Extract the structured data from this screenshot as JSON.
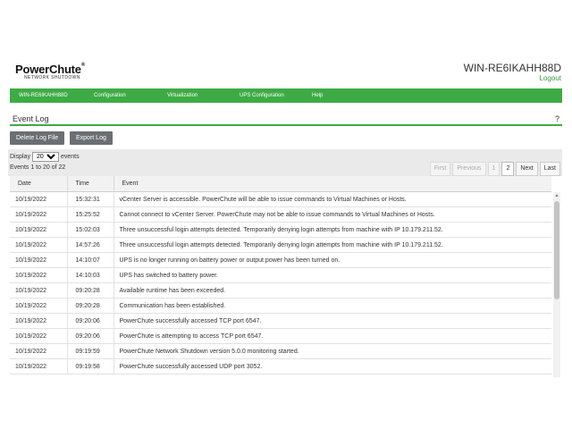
{
  "header": {
    "brand": "PowerChute",
    "trademark": "®",
    "subtitle": "NETWORK SHUTDOWN",
    "hostname": "WIN-RE6IKAHH88D",
    "logout_label": "Logout"
  },
  "nav": {
    "items": [
      "WIN-RE6IKAHH88D",
      "Configuration",
      "Virtualization",
      "UPS Configuration",
      "Help"
    ]
  },
  "section": {
    "title": "Event Log",
    "help": "?"
  },
  "buttons": {
    "delete_label": "Delete Log File",
    "export_label": "Export Log"
  },
  "toolbar": {
    "display_label": "Display",
    "display_value": "20",
    "events_label": "events",
    "count_text": "Events 1 to 20 of 22"
  },
  "pager": {
    "first": "First",
    "previous": "Previous",
    "page1": "1",
    "page2": "2",
    "next": "Next",
    "last": "Last"
  },
  "table": {
    "headers": [
      "Date",
      "Time",
      "Event"
    ],
    "rows": [
      {
        "date": "10/19/2022",
        "time": "15:32:31",
        "event": "vCenter Server is accessible. PowerChute will be able to issue commands to Virtual Machines or Hosts."
      },
      {
        "date": "10/19/2022",
        "time": "15:25:52",
        "event": "Cannot connect to vCenter Server. PowerChute may not be able to issue commands to Virtual Machines or Hosts."
      },
      {
        "date": "10/19/2022",
        "time": "15:02:03",
        "event": "Three unsuccessful login attempts detected. Temporarily denying login attempts from machine with IP 10.179.211.52."
      },
      {
        "date": "10/19/2022",
        "time": "14:57:26",
        "event": "Three unsuccessful login attempts detected. Temporarily denying login attempts from machine with IP 10.179.211.52."
      },
      {
        "date": "10/19/2022",
        "time": "14:10:07",
        "event": "UPS is no longer running on battery power or output power has been turned on."
      },
      {
        "date": "10/19/2022",
        "time": "14:10:03",
        "event": "UPS has switched to battery power."
      },
      {
        "date": "10/19/2022",
        "time": "09:20:28",
        "event": "Available runtime has been exceeded."
      },
      {
        "date": "10/19/2022",
        "time": "09:20:28",
        "event": "Communication has been established."
      },
      {
        "date": "10/19/2022",
        "time": "09:20:06",
        "event": "PowerChute successfully accessed TCP port 6547."
      },
      {
        "date": "10/19/2022",
        "time": "09:20:06",
        "event": "PowerChute is attempting to access TCP port 6547."
      },
      {
        "date": "10/19/2022",
        "time": "09:19:59",
        "event": "PowerChute Network Shutdown version 5.0.0 monitoring started."
      },
      {
        "date": "10/19/2022",
        "time": "09:19:58",
        "event": "PowerChute successfully accessed UDP port 3052."
      }
    ]
  },
  "colors": {
    "accent": "#3dab44",
    "button": "#6b6f73"
  }
}
